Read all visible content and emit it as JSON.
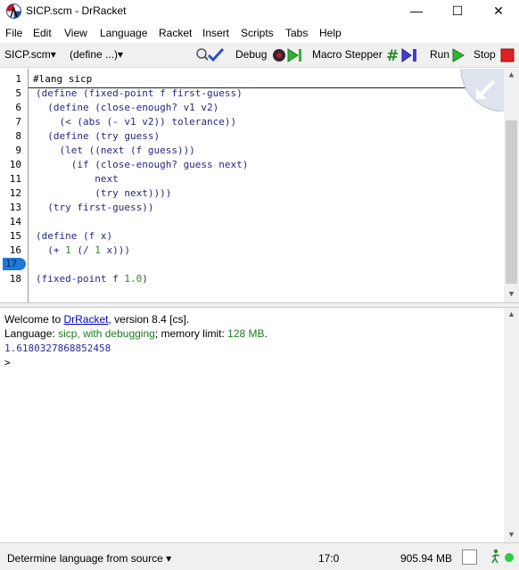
{
  "window": {
    "title": "SICP.scm - DrRacket",
    "minimize": "—",
    "maximize": "☐",
    "close": "✕"
  },
  "menu": [
    "File",
    "Edit",
    "View",
    "Language",
    "Racket",
    "Insert",
    "Scripts",
    "Tabs",
    "Help"
  ],
  "toolbar": {
    "file_dropdown": "SICP.scm▾",
    "define_dropdown": "(define ...)▾",
    "debug_label": "Debug",
    "macro_label": "Macro Stepper",
    "run_label": "Run",
    "stop_label": "Stop"
  },
  "editor": {
    "lang_line": "#lang sicp",
    "line_numbers": [
      "1",
      "5",
      "6",
      "7",
      "8",
      "9",
      "10",
      "11",
      "12",
      "13",
      "14",
      "15",
      "16",
      "17",
      "18"
    ],
    "lines": [
      "(define (fixed-point f first-guess)",
      "  (define (close-enough? v1 v2)",
      "    (< (abs (- v1 v2)) tolerance))",
      "  (define (try guess)",
      "    (let ((next (f guess)))",
      "      (if (close-enough? guess next)",
      "          next",
      "          (try next))))",
      "  (try first-guess))",
      "",
      "(define (f x)",
      "  (+ ",
      "",
      "(fixed-point f "
    ],
    "line16_nums": [
      "1",
      "1"
    ],
    "line16_tail": " x)))",
    "line16_mid": " (/ ",
    "line18_num": "1.0",
    "line18_tail": ")"
  },
  "repl": {
    "welcome_prefix": "Welcome to ",
    "welcome_link": "DrRacket",
    "welcome_suffix": ", version 8.4 [cs].",
    "lang_prefix": "Language: ",
    "lang_name": "sicp, with debugging",
    "lang_mid": "; memory limit: ",
    "lang_limit": "128 MB",
    "lang_end": ".",
    "output": "1.6180327868852458",
    "prompt": ">"
  },
  "status": {
    "language": "Determine language from source ▾",
    "position": "17:0",
    "memory": "905.94 MB"
  },
  "colors": {
    "code": "#262680",
    "number": "#228b22",
    "highlight": "#1e7ad6",
    "link": "#0000cc"
  }
}
